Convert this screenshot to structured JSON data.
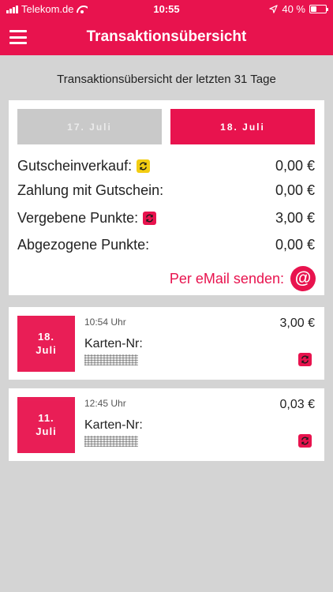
{
  "status_bar": {
    "carrier": "Telekom.de",
    "time": "10:55",
    "battery_percent": "40 %",
    "battery_level": 0.4
  },
  "nav": {
    "title": "Transaktionsübersicht",
    "menu_icon": "hamburger-menu-icon"
  },
  "subtitle": "Transaktionsübersicht der letzten 31 Tage",
  "period_buttons": {
    "previous": "17.  Juli",
    "current": "18.  Juli"
  },
  "summary": {
    "rows": [
      {
        "label": "Gutscheinverkauf:",
        "value": "0,00 €",
        "icon": "voucher-exchange-icon",
        "icon_color": "#f3cd12"
      },
      {
        "label": "Zahlung mit Gutschein:",
        "value": "0,00 €"
      },
      {
        "label": "Vergebene Punkte:",
        "value": "3,00 €",
        "icon": "points-exchange-icon",
        "icon_color": "#e8134e"
      },
      {
        "label": "Abgezogene Punkte:",
        "value": "0,00 €"
      }
    ],
    "email_label": "Per eMail senden:",
    "email_icon": "at-icon"
  },
  "transactions": [
    {
      "date": "18.\nJuli",
      "time": "10:54 Uhr",
      "amount": "3,00 €",
      "card_label": "Karten-Nr:",
      "icon": "points-exchange-icon"
    },
    {
      "date": "11.\nJuli",
      "time": "12:45 Uhr",
      "amount": "0,03 €",
      "card_label": "Karten-Nr:",
      "icon": "points-exchange-icon"
    }
  ],
  "colors": {
    "accent": "#e8134e",
    "voucher": "#f3cd12",
    "background": "#d4d4d4"
  }
}
